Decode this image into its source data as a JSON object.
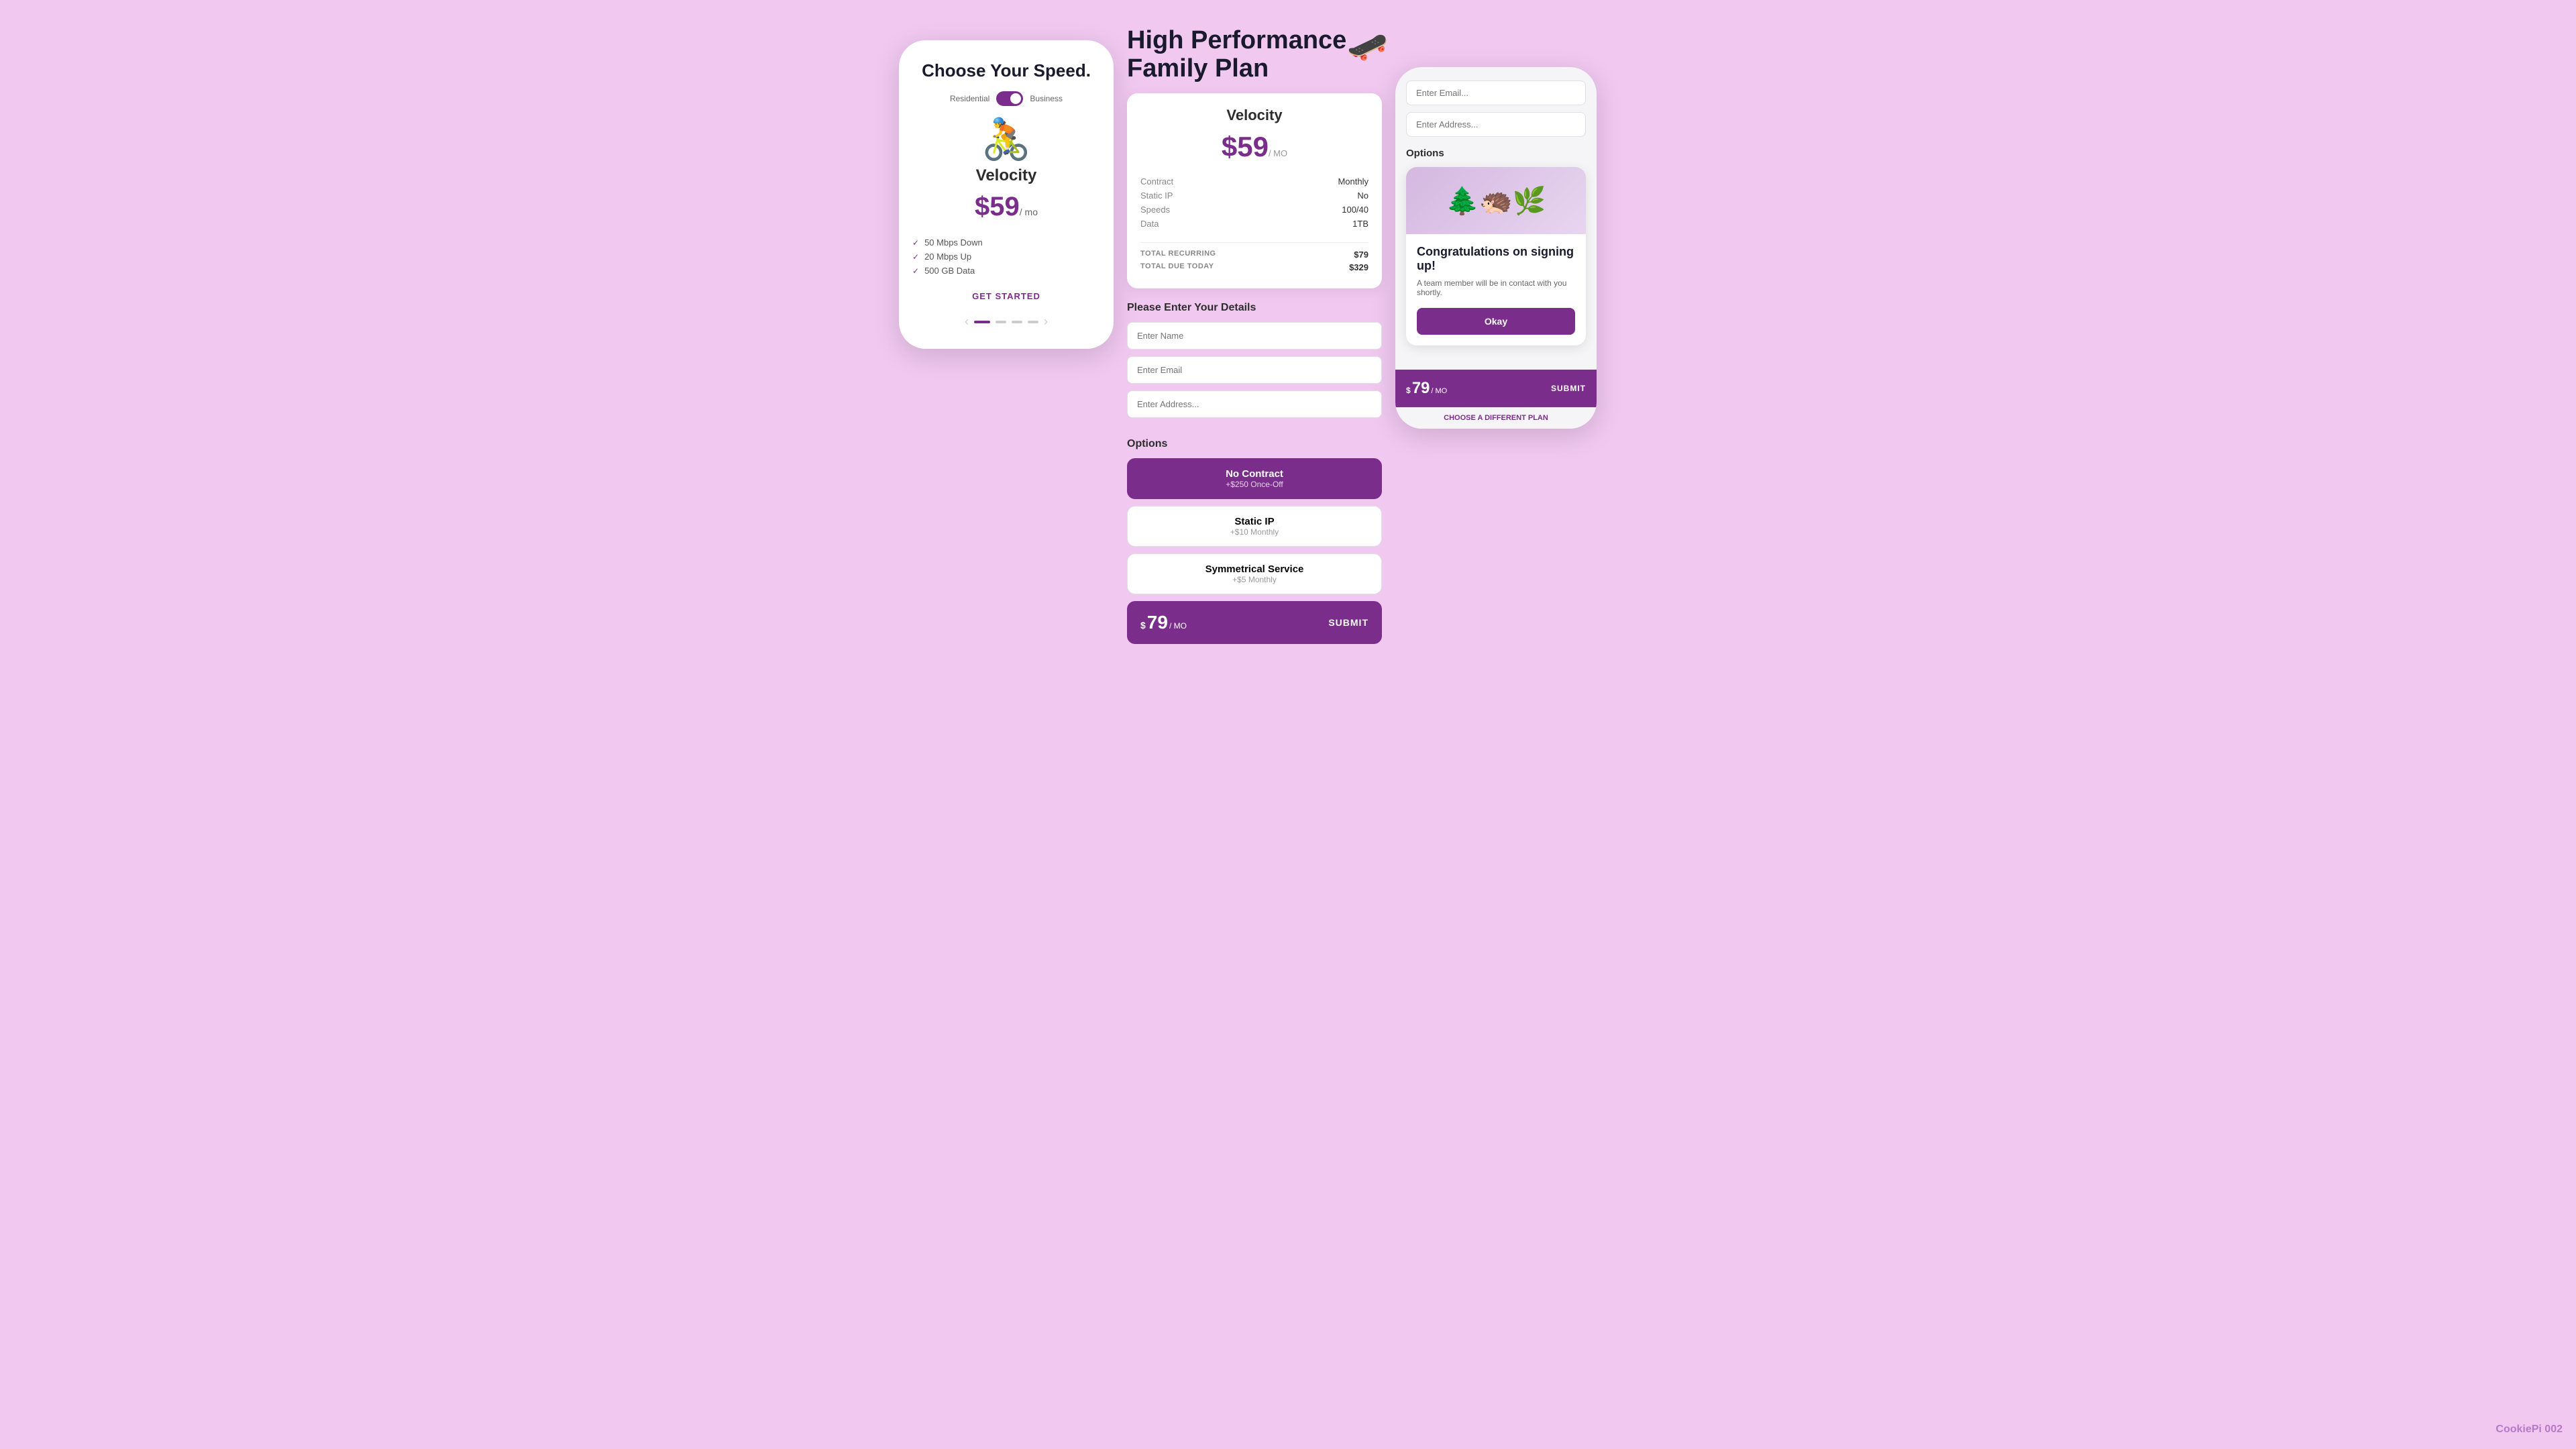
{
  "page": {
    "background": "#f0c8f0",
    "watermark": "CookiePi\n002"
  },
  "left_phone": {
    "title": "Choose Your Speed.",
    "toggle": {
      "left_label": "Residential",
      "right_label": "Business",
      "active": "Business"
    },
    "plan_name": "Velocity",
    "price": "$59",
    "per": "/ mo",
    "features": [
      "50 Mbps Down",
      "20 Mbps Up",
      "500 GB Data"
    ],
    "cta": "GET STARTED",
    "carousel": {
      "active_dot": 0,
      "total_dots": 4
    }
  },
  "middle": {
    "plan_header": "High Performance Family Plan",
    "plan_card": {
      "name": "Velocity",
      "price": "$59",
      "per_mo": "/ MO",
      "details": [
        {
          "label": "Contract",
          "value": "Monthly"
        },
        {
          "label": "Static IP",
          "value": "No"
        },
        {
          "label": "Speeds",
          "value": "100/40"
        },
        {
          "label": "Data",
          "value": "1TB"
        }
      ],
      "total_recurring_label": "TOTAL RECURRING",
      "total_recurring_value": "$79",
      "total_due_label": "TOTAL DUE TODAY",
      "total_due_value": "$329"
    },
    "form": {
      "title": "Please Enter Your Details",
      "name_placeholder": "Enter Name",
      "email_placeholder": "Enter Email",
      "address_placeholder": "Enter Address..."
    },
    "options": {
      "title": "Options",
      "items": [
        {
          "name": "No Contract",
          "sub": "+$250 Once-Off",
          "selected": true
        },
        {
          "name": "Static IP",
          "sub": "+$10 Monthly",
          "selected": false
        },
        {
          "name": "Symmetrical Service",
          "sub": "+$5 Monthly",
          "selected": false
        }
      ]
    },
    "bottom_bar": {
      "price_sup": "$",
      "price_num": "79",
      "price_mo": "/ MO",
      "submit_label": "SUBMIT"
    }
  },
  "right_phone": {
    "email_placeholder": "Enter Email...",
    "address_placeholder": "Enter Address...",
    "options_label": "Options",
    "congrats": {
      "title": "Congratulations on signing up!",
      "message": "A team member will be in contact with you shortly.",
      "okay_label": "Okay"
    },
    "bottom_bar": {
      "price_sup": "$",
      "price_num": "79",
      "price_mo": "/ MO",
      "submit_label": "SUBMIT"
    },
    "change_plan": "CHOOSE A DIFFERENT PLAN"
  }
}
